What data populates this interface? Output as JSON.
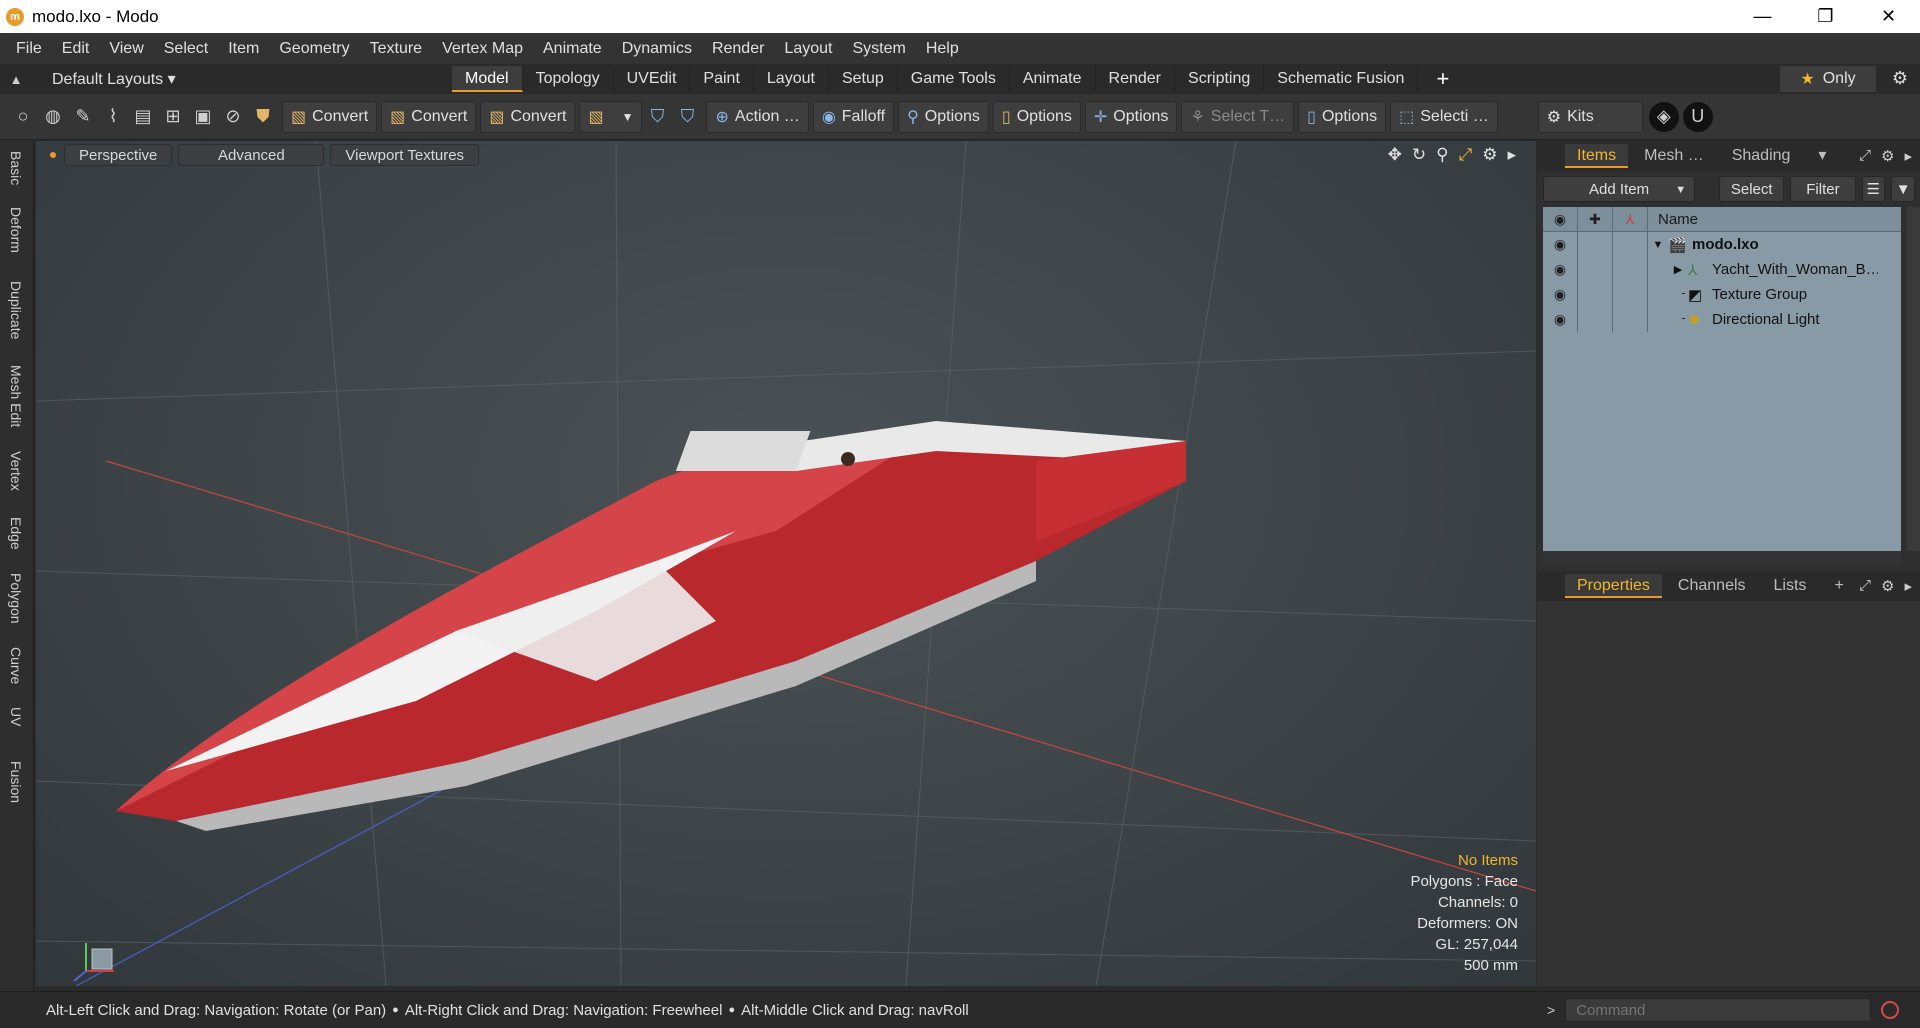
{
  "window": {
    "title": "modo.lxo - Modo",
    "minimize": "—",
    "maximize": "❐",
    "close": "✕"
  },
  "menu": [
    "File",
    "Edit",
    "View",
    "Select",
    "Item",
    "Geometry",
    "Texture",
    "Vertex Map",
    "Animate",
    "Dynamics",
    "Render",
    "Layout",
    "System",
    "Help"
  ],
  "layout_bar": {
    "layouts_label": "Default Layouts ▾",
    "tabs": [
      "Model",
      "Topology",
      "UVEdit",
      "Paint",
      "Layout",
      "Setup",
      "Game Tools",
      "Animate",
      "Render",
      "Scripting",
      "Schematic Fusion"
    ],
    "active_tab": "Model",
    "only_label": "Only"
  },
  "toolbar": {
    "convert1": "Convert",
    "convert2": "Convert",
    "convert3": "Convert",
    "action": "Action …",
    "falloff": "Falloff",
    "options1": "Options",
    "options2": "Options",
    "options3": "Options",
    "select_t": "Select T…",
    "options4": "Options",
    "selecti": "Selecti …",
    "kits": "Kits"
  },
  "left_tabs": [
    "Basic",
    "Deform",
    "Duplicate",
    "Mesh Edit",
    "Vertex",
    "Edge",
    "Polygon",
    "Curve",
    "UV",
    "Fusion"
  ],
  "viewport": {
    "tabs": [
      "Perspective",
      "Advanced",
      "Viewport Textures"
    ],
    "info": {
      "no_items": "No Items",
      "polygons": "Polygons : Face",
      "channels": "Channels: 0",
      "deformers": "Deformers: ON",
      "gl": "GL: 257,044",
      "scale": "500 mm"
    }
  },
  "items_panel": {
    "tabs": [
      "Items",
      "Mesh …",
      "Shading"
    ],
    "add_item": "Add Item",
    "select": "Select",
    "filter": "Filter",
    "name_header": "Name",
    "rows": [
      {
        "label": "modo.lxo",
        "bold": true,
        "expander": "▼",
        "icon": "scene-icon"
      },
      {
        "label": "Yacht_With_Woman_B…",
        "bold": false,
        "expander": "▶",
        "icon": "locator-icon"
      },
      {
        "label": "Texture Group",
        "bold": false,
        "expander": "",
        "icon": "texture-group-icon"
      },
      {
        "label": "Directional Light",
        "bold": false,
        "expander": "",
        "icon": "light-icon"
      }
    ]
  },
  "props_panel": {
    "tabs": [
      "Properties",
      "Channels",
      "Lists"
    ],
    "plus": "+"
  },
  "status": {
    "hint1": "Alt-Left Click and Drag: Navigation: Rotate (or Pan)",
    "hint2": "Alt-Right Click and Drag: Navigation: Freewheel",
    "hint3": "Alt-Middle Click and Drag: navRoll"
  },
  "command": {
    "placeholder": "Command"
  },
  "colors": {
    "accent": "#e89a2b",
    "hull_red": "#c8383a",
    "list_bg": "#889aa5"
  }
}
